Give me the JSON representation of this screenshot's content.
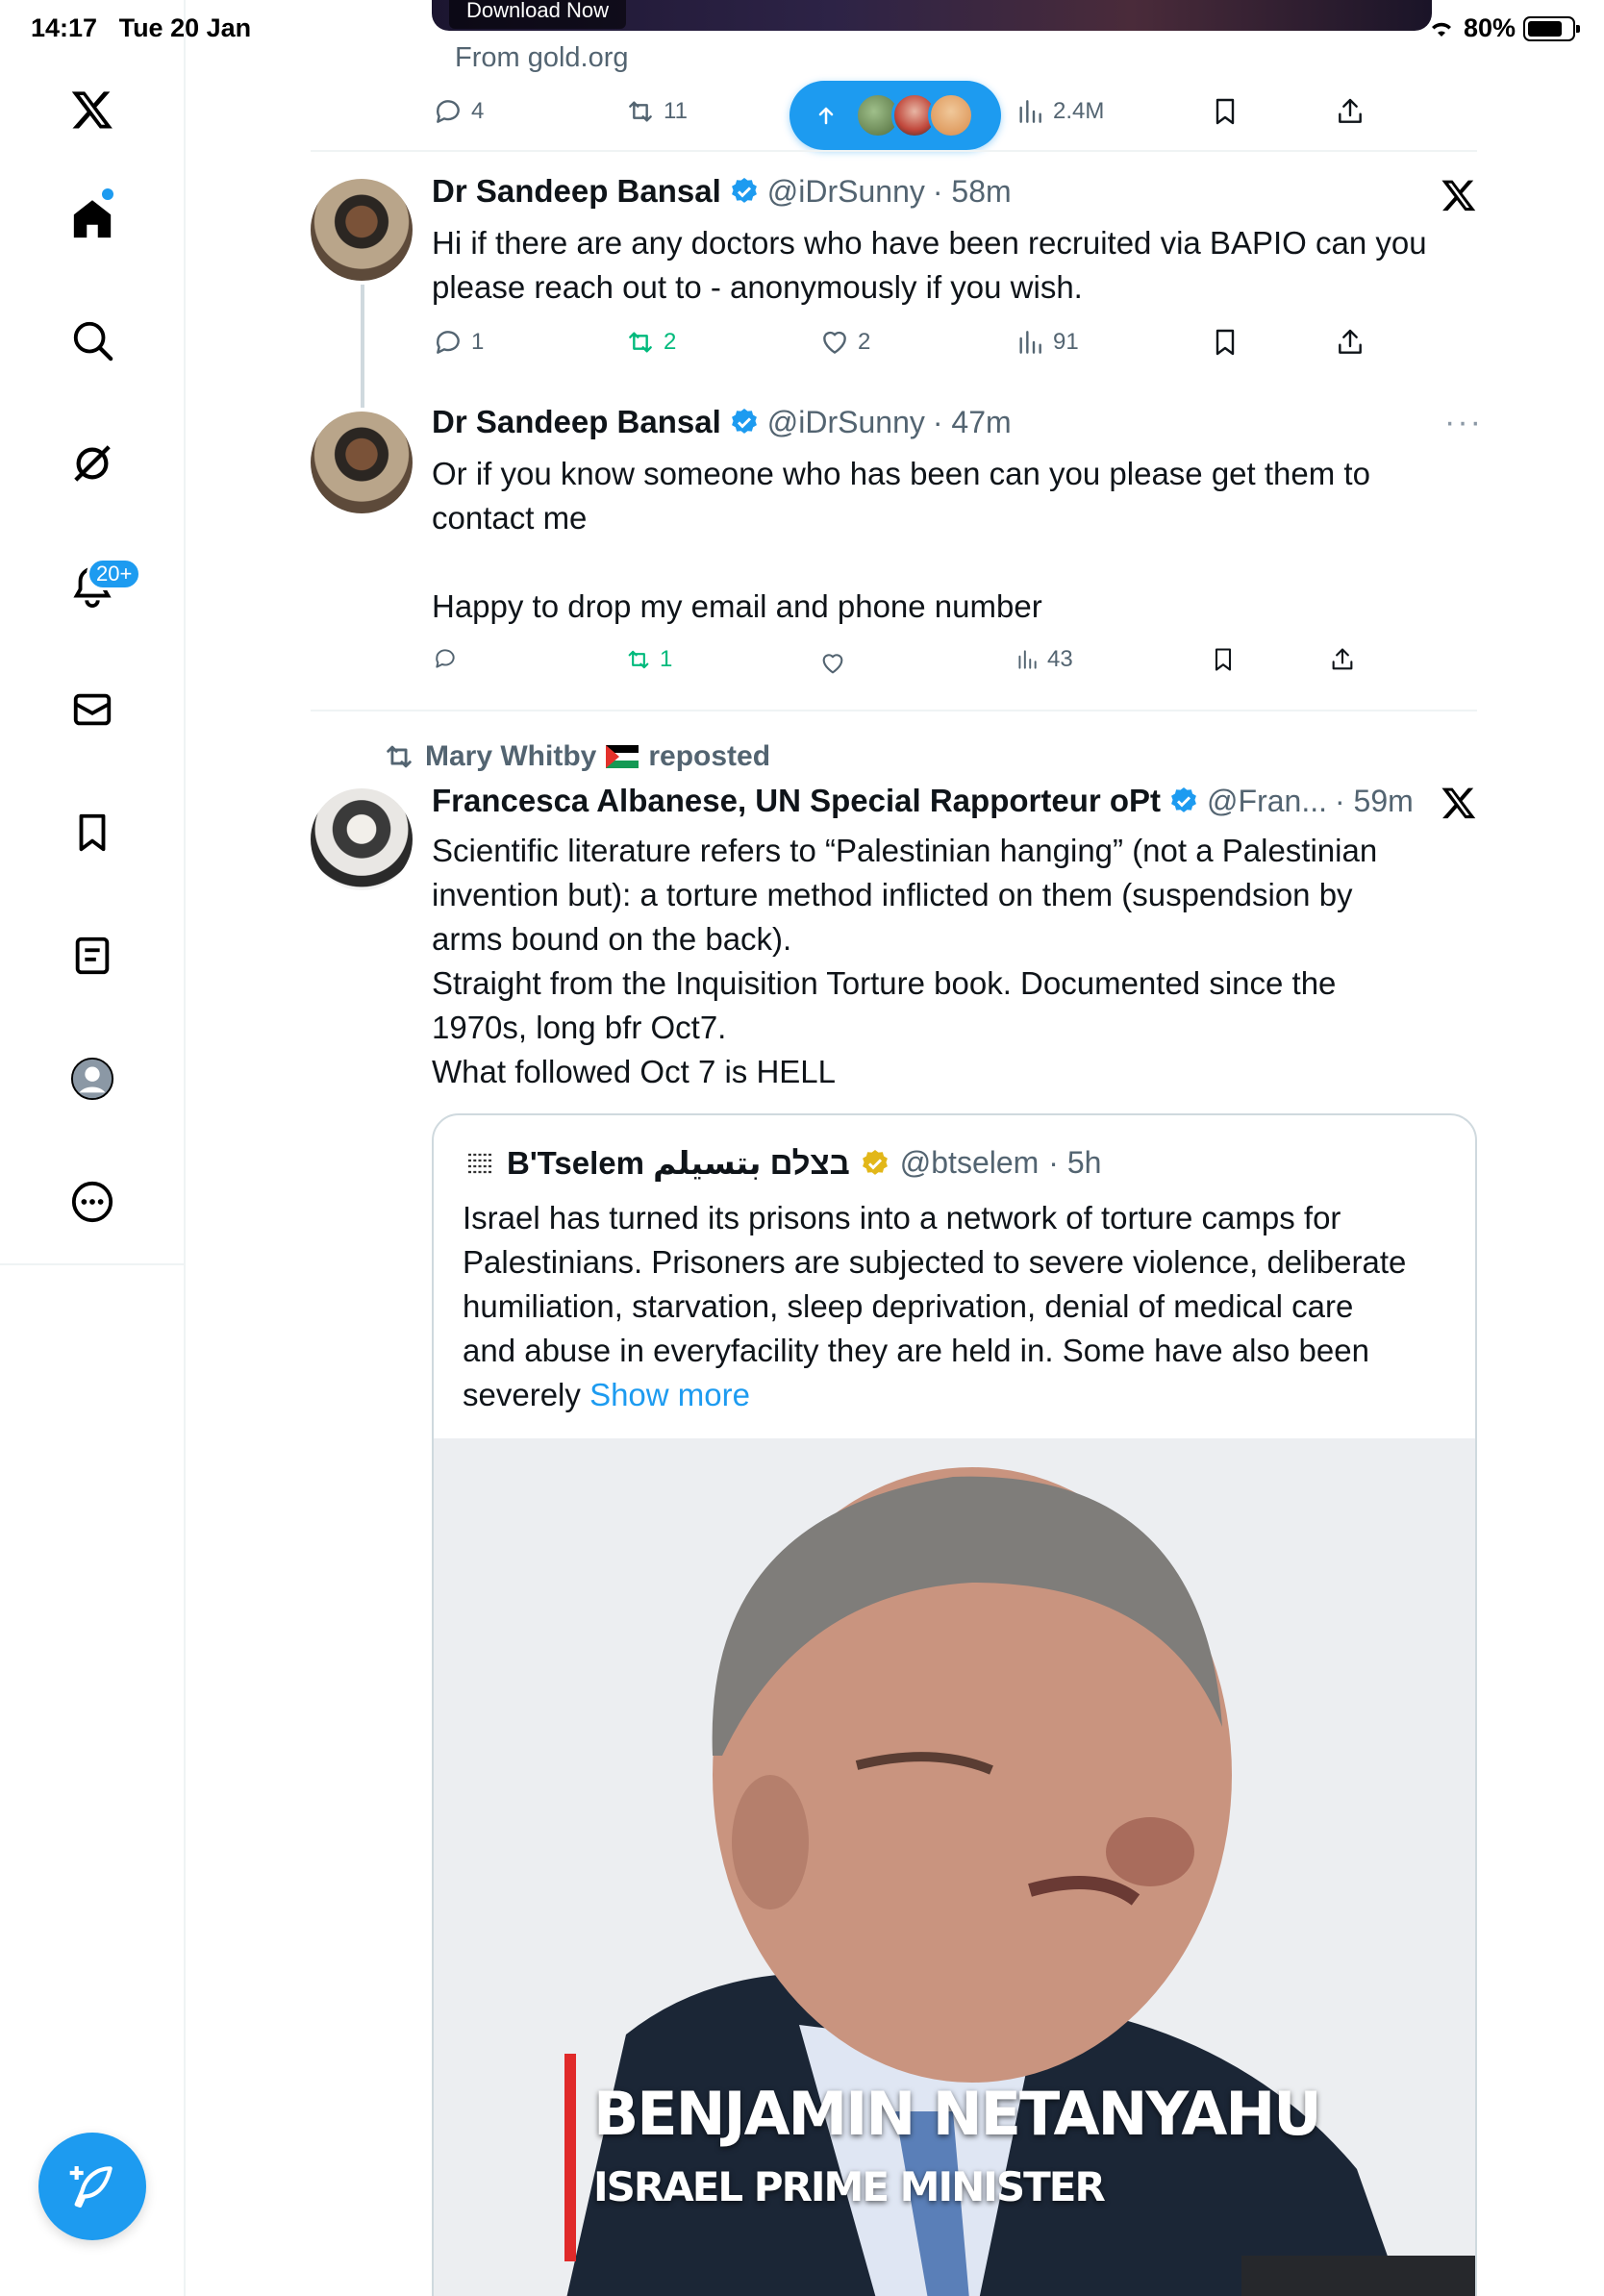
{
  "status": {
    "time": "14:17",
    "date": "Tue 20 Jan",
    "battery": "80%"
  },
  "sidebar": {
    "notifications_badge": "20+",
    "items": [
      "x-logo-icon",
      "home-icon",
      "search-icon",
      "grok-icon",
      "bell-icon",
      "mail-icon",
      "bookmark-icon",
      "lists-icon",
      "profile-icon",
      "more-icon"
    ]
  },
  "ad": {
    "button_label": "Download Now",
    "source": "From gold.org",
    "replies": "4",
    "reposts": "11",
    "views": "2.4M"
  },
  "tweets": [
    {
      "name": "Dr Sandeep Bansal",
      "handle": "@iDrSunny",
      "time": "· 58m",
      "text_lines": [
        "Hi if there are any doctors who have been recruited via BAPIO can you",
        "please reach out to - anonymously if you wish."
      ],
      "replies": "1",
      "reposts": "2",
      "likes": "2",
      "views": "91"
    },
    {
      "name": "Dr Sandeep Bansal",
      "handle": "@iDrSunny",
      "time": "· 47m",
      "text_lines": [
        "Or if you know someone who has been can you please get them to",
        "contact me",
        "",
        "Happy to drop my email and phone number"
      ],
      "reposts": "1",
      "views": "43"
    },
    {
      "repost_by": "Mary Whitby",
      "repost_label": "reposted",
      "name": "Francesca Albanese, UN Special Rapporteur oPt",
      "handle": "@Fran...",
      "time": "· 59m",
      "text_lines": [
        "Scientific literature refers to “Palestinian hanging” (not a Palestinian",
        "invention but): a torture method inflicted on them (suspendsion by",
        "arms bound on the back).",
        "Straight from the Inquisition Torture book. Documented since the",
        "1970s, long bfr Oct7.",
        "What followed Oct 7 is HELL"
      ],
      "quote": {
        "name": "B'Tselem בצלם بتسيلم",
        "handle": "@btselem",
        "time": "· 5h",
        "text_lines": [
          "Israel has turned its prisons into a network of torture camps for",
          "Palestinians. Prisoners are subjected to severe violence, deliberate",
          "humiliation, starvation, sleep deprivation, denial of medical care",
          "and abuse in everyfacility they are held in. Some have also been"
        ],
        "last_line": "severely",
        "show_more": "Show more",
        "video_name": "BENJAMIN NETANYAHU",
        "video_title": "ISRAEL PRIME MINISTER"
      }
    }
  ],
  "colors": {
    "accent": "#1d9bf0",
    "repost_green": "#00ba7c",
    "muted": "#536471",
    "gold_badge": "#e2b719"
  }
}
